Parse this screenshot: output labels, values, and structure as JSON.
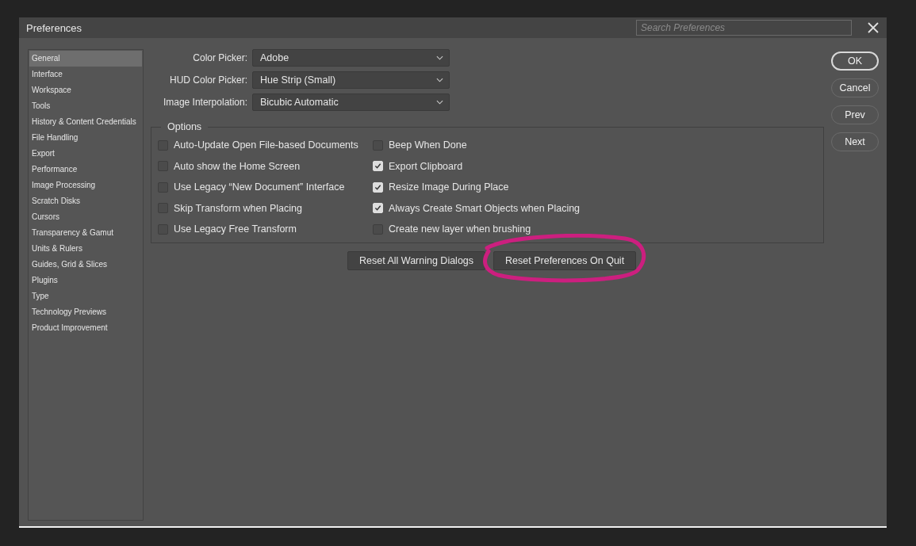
{
  "window": {
    "title": "Preferences"
  },
  "search": {
    "placeholder": "Search Preferences"
  },
  "sidebar": {
    "items": [
      {
        "label": "General",
        "selected": true
      },
      {
        "label": "Interface",
        "selected": false
      },
      {
        "label": "Workspace",
        "selected": false
      },
      {
        "label": "Tools",
        "selected": false
      },
      {
        "label": "History & Content Credentials",
        "selected": false
      },
      {
        "label": "File Handling",
        "selected": false
      },
      {
        "label": "Export",
        "selected": false
      },
      {
        "label": "Performance",
        "selected": false
      },
      {
        "label": "Image Processing",
        "selected": false
      },
      {
        "label": "Scratch Disks",
        "selected": false
      },
      {
        "label": "Cursors",
        "selected": false
      },
      {
        "label": "Transparency & Gamut",
        "selected": false
      },
      {
        "label": "Units & Rulers",
        "selected": false
      },
      {
        "label": "Guides, Grid & Slices",
        "selected": false
      },
      {
        "label": "Plugins",
        "selected": false
      },
      {
        "label": "Type",
        "selected": false
      },
      {
        "label": "Technology Previews",
        "selected": false
      },
      {
        "label": "Product Improvement",
        "selected": false
      }
    ]
  },
  "fields": [
    {
      "label": "Color Picker:",
      "value": "Adobe"
    },
    {
      "label": "HUD Color Picker:",
      "value": "Hue Strip (Small)"
    },
    {
      "label": "Image Interpolation:",
      "value": "Bicubic Automatic"
    }
  ],
  "options": {
    "title": "Options",
    "columns": [
      [
        {
          "label": "Auto-Update Open File-based Documents",
          "checked": false
        },
        {
          "label": "Auto show the Home Screen",
          "checked": false
        },
        {
          "label": "Use Legacy “New Document” Interface",
          "checked": false
        },
        {
          "label": "Skip Transform when Placing",
          "checked": false
        },
        {
          "label": "Use Legacy Free Transform",
          "checked": false
        }
      ],
      [
        {
          "label": "Beep When Done",
          "checked": false
        },
        {
          "label": "Export Clipboard",
          "checked": true
        },
        {
          "label": "Resize Image During Place",
          "checked": true
        },
        {
          "label": "Always Create Smart Objects when Placing",
          "checked": true
        },
        {
          "label": "Create new layer when brushing",
          "checked": false
        }
      ]
    ]
  },
  "reset_buttons": [
    {
      "label": "Reset All Warning Dialogs",
      "circled": false
    },
    {
      "label": "Reset Preferences On Quit",
      "circled": true
    }
  ],
  "side_buttons": [
    {
      "label": "OK",
      "default": true
    },
    {
      "label": "Cancel",
      "default": false
    },
    {
      "label": "Prev",
      "default": false
    },
    {
      "label": "Next",
      "default": false
    }
  ]
}
